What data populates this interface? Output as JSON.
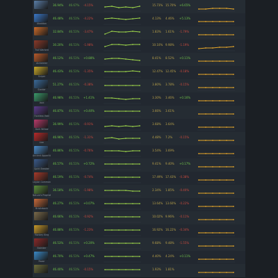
{
  "rows": [
    {
      "name": "",
      "color": "#5a7ea8",
      "wr": "36.94%",
      "wr_red": false,
      "c2": "46.67%",
      "c3": "-4.15%",
      "c3_green": false,
      "c5": "15.73%",
      "c6": "15.70%",
      "c7": "+6.65%",
      "c7_green": true,
      "spark1": [
        6,
        7,
        5,
        6,
        5,
        7
      ],
      "spark2": [
        3,
        3,
        4,
        4,
        4,
        3
      ]
    },
    {
      "name": "Abaddon",
      "color": "#3a78c8",
      "wr": "46.48%",
      "wr_red": false,
      "c2": "46.51%",
      "c3": "-4.22%",
      "c3_green": false,
      "c5": "4.13%",
      "c6": "4.46%",
      "c7": "+5.13%",
      "c7_green": true,
      "spark1": [
        8,
        9,
        8,
        7,
        8,
        9
      ],
      "spark2": [
        4,
        4,
        4,
        4,
        4,
        4
      ]
    },
    {
      "name": "",
      "color": "#c86a2a",
      "wr": "32.84%",
      "wr_red": false,
      "c2": "46.51%",
      "c3": "-3.47%",
      "c3_green": false,
      "c5": "1.83%",
      "c6": "1.61%",
      "c7": "-1.79%",
      "c7_green": false,
      "spark1": [
        5,
        9,
        8,
        8,
        9,
        8
      ],
      "spark2": [
        4,
        4,
        4,
        4,
        4,
        4
      ]
    },
    {
      "name": "Troll Warlord",
      "color": "#8a3a2a",
      "wr": "30.20%",
      "wr_red": false,
      "c2": "46.51%",
      "c3": "-1.98%",
      "c3_green": false,
      "c5": "10.10%",
      "c6": "9.98%",
      "c7": "-1.19%",
      "c7_green": false,
      "spark1": [
        6,
        9,
        9,
        8,
        9,
        9
      ],
      "spark2": [
        3,
        4,
        4,
        5,
        5,
        6
      ]
    },
    {
      "name": "Alchemist",
      "color": "#b85a2a",
      "wr": "46.12%",
      "wr_red": false,
      "c2": "46.51%",
      "c3": "+0.88%",
      "c3_green": true,
      "c5": "8.41%",
      "c6": "8.52%",
      "c7": "+0.11%",
      "c7_green": true,
      "spark1": [
        7,
        8,
        8,
        7,
        6,
        5
      ],
      "spark2": [
        4,
        4,
        4,
        4,
        4,
        4
      ]
    },
    {
      "name": "Sniper",
      "color": "#c8a82a",
      "wr": "46.43%",
      "wr_red": false,
      "c2": "46.51%",
      "c3": "-1.35%",
      "c3_green": false,
      "c5": "12.47%",
      "c6": "12.45%",
      "c7": "-0.18%",
      "c7_green": false,
      "spark1": [
        8,
        8,
        8,
        8,
        9,
        8
      ],
      "spark2": [
        4,
        4,
        4,
        4,
        4,
        4
      ]
    },
    {
      "name": "Slardar",
      "color": "#3a6a9a",
      "wr": "51.27%",
      "wr_red": false,
      "c2": "46.51%",
      "c3": "-0.38%",
      "c3_green": false,
      "c5": "3.80%",
      "c6": "3.78%",
      "c7": "-0.15%",
      "c7_green": false,
      "spark1": [
        7,
        7,
        7,
        7,
        7,
        7
      ],
      "spark2": [
        4,
        4,
        4,
        4,
        4,
        4
      ]
    },
    {
      "name": "Void",
      "color": "#3a9a6a",
      "wr": "46.98%",
      "wr_red": false,
      "c2": "46.51%",
      "c3": "+1.41%",
      "c3_green": true,
      "c5": "3.30%",
      "c6": "3.46%",
      "c7": "+0.16%",
      "c7_green": true,
      "spark1": [
        8,
        8,
        7,
        6,
        7,
        7
      ],
      "spark2": [
        4,
        4,
        4,
        4,
        4,
        4
      ]
    },
    {
      "name": "Faceless Void",
      "color": "#5a3a8a",
      "wr": "46.87%",
      "wr_red": false,
      "c2": "46.51%",
      "c3": "+0.40%",
      "c3_green": true,
      "c5": "3.66%",
      "c6": "3.61%",
      "c7": "",
      "c7_green": false,
      "spark1": [
        8,
        8,
        8,
        8,
        8,
        8
      ],
      "spark2": [
        4,
        4,
        4,
        4,
        4,
        4
      ]
    },
    {
      "name": "Dark Willow",
      "color": "#b83a6a",
      "wr": "36.99%",
      "wr_red": false,
      "c2": "46.51%",
      "c3": "-0.91%",
      "c3_green": false,
      "c5": "3.68%",
      "c6": "3.64%",
      "c7": "",
      "c7_green": false,
      "spark1": [
        5,
        6,
        5,
        6,
        5,
        6
      ],
      "spark2": [
        4,
        4,
        4,
        4,
        4,
        4
      ]
    },
    {
      "name": "Lion",
      "color": "#b82a2a",
      "wr": "46.96%",
      "wr_red": false,
      "c2": "46.51%",
      "c3": "-1.31%",
      "c3_green": false,
      "c5": "4.48%",
      "c6": "7.2%",
      "c7": "-0.15%",
      "c7_green": false,
      "spark1": [
        7,
        8,
        6,
        7,
        7,
        7
      ],
      "spark2": [
        4,
        4,
        4,
        4,
        4,
        4
      ]
    },
    {
      "name": "Ancient Apparition",
      "color": "#4a8ac8",
      "wr": "46.86%",
      "wr_red": false,
      "c2": "46.51%",
      "c3": "-0.76%",
      "c3_green": false,
      "c5": "3.54%",
      "c6": "3.69%",
      "c7": "",
      "c7_green": false,
      "spark1": [
        8,
        8,
        8,
        7,
        8,
        8
      ],
      "spark2": [
        4,
        4,
        4,
        4,
        4,
        4
      ]
    },
    {
      "name": "Spirit Breaker",
      "color": "#3a5a8a",
      "wr": "46.57%",
      "wr_red": false,
      "c2": "46.51%",
      "c3": "+0.72%",
      "c3_green": true,
      "c5": "9.41%",
      "c6": "9.40%",
      "c7": "+0.17%",
      "c7_green": true,
      "spark1": [
        8,
        8,
        8,
        8,
        8,
        8
      ],
      "spark2": [
        4,
        4,
        4,
        4,
        4,
        4
      ]
    },
    {
      "name": "Legion Commander",
      "color": "#a83a2a",
      "wr": "46.19%",
      "wr_red": false,
      "c2": "46.51%",
      "c3": "-0.74%",
      "c3_green": false,
      "c5": "17.49%",
      "c6": "17.43%",
      "c7": "-0.38%",
      "c7_green": false,
      "spark1": [
        8,
        8,
        8,
        8,
        8,
        8
      ],
      "spark2": [
        4,
        4,
        4,
        4,
        4,
        4
      ]
    },
    {
      "name": "Nature's Prophet",
      "color": "#5a8a3a",
      "wr": "36.18%",
      "wr_red": false,
      "c2": "46.51%",
      "c3": "-1.98%",
      "c3_green": false,
      "c5": "2.34%",
      "c6": "1.85%",
      "c7": "-0.40%",
      "c7_green": false,
      "spark1": [
        8,
        8,
        8,
        8,
        7,
        7
      ],
      "spark2": [
        4,
        4,
        4,
        4,
        4,
        4
      ]
    },
    {
      "name": "Bristleback",
      "color": "#c86a3a",
      "wr": "46.27%",
      "wr_red": false,
      "c2": "46.51%",
      "c3": "+0.07%",
      "c3_green": true,
      "c5": "13.64%",
      "c6": "13.60%",
      "c7": "-0.22%",
      "c7_green": false,
      "spark1": [
        8,
        8,
        8,
        8,
        8,
        8
      ],
      "spark2": [
        4,
        4,
        4,
        4,
        4,
        4
      ]
    },
    {
      "name": "",
      "color": "#7a6a4a",
      "wr": "46.66%",
      "wr_red": false,
      "c2": "46.51%",
      "c3": "-0.92%",
      "c3_green": false,
      "c5": "10.02%",
      "c6": "9.96%",
      "c7": "-0.11%",
      "c7_green": false,
      "spark1": [
        8,
        8,
        8,
        8,
        8,
        8
      ],
      "spark2": [
        4,
        4,
        4,
        4,
        4,
        4
      ]
    },
    {
      "name": "Monkey King",
      "color": "#c89a2a",
      "wr": "46.88%",
      "wr_red": false,
      "c2": "46.51%",
      "c3": "-1.23%",
      "c3_green": false,
      "c5": "16.92%",
      "c6": "16.22%",
      "c7": "-0.34%",
      "c7_green": false,
      "spark1": [
        8,
        8,
        8,
        8,
        8,
        8
      ],
      "spark2": [
        4,
        4,
        4,
        4,
        4,
        4
      ]
    },
    {
      "name": "Batrider",
      "color": "#8a2a2a",
      "wr": "46.53%",
      "wr_red": false,
      "c2": "46.51%",
      "c3": "+0.20%",
      "c3_green": true,
      "c5": "9.68%",
      "c6": "9.48%",
      "c7": "-1.55%",
      "c7_green": false,
      "spark1": [
        8,
        8,
        8,
        8,
        8,
        8
      ],
      "spark2": [
        4,
        4,
        4,
        4,
        4,
        4
      ]
    },
    {
      "name": "Razor",
      "color": "#3a8ac8",
      "wr": "46.70%",
      "wr_red": false,
      "c2": "46.51%",
      "c3": "+0.47%",
      "c3_green": true,
      "c5": "4.40%",
      "c6": "4.24%",
      "c7": "+0.11%",
      "c7_green": true,
      "spark1": [
        8,
        8,
        8,
        8,
        8,
        8
      ],
      "spark2": [
        4,
        4,
        4,
        4,
        4,
        4
      ]
    },
    {
      "name": "",
      "color": "#6a6a3a",
      "wr": "46.40%",
      "wr_red": false,
      "c2": "46.51%",
      "c3": "-0.15%",
      "c3_green": false,
      "c5": "1.93%",
      "c6": "1.81%",
      "c7": "",
      "c7_green": false,
      "spark1": [
        8,
        8,
        8,
        8,
        8,
        8
      ],
      "spark2": [
        4,
        4,
        4,
        4,
        4,
        4
      ]
    }
  ]
}
